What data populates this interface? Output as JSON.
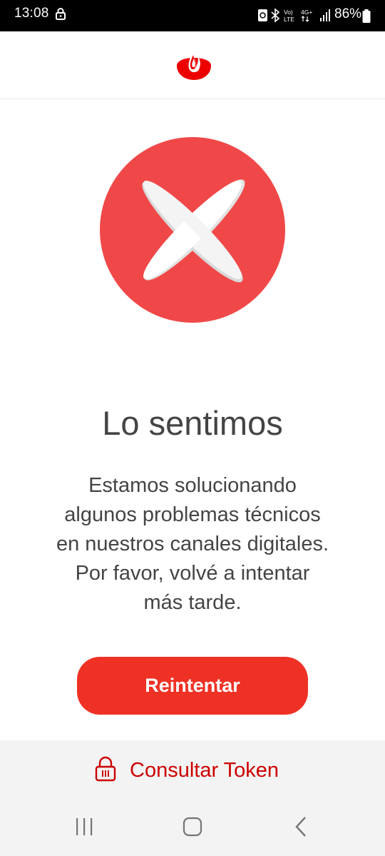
{
  "status_bar": {
    "time": "13:08",
    "battery": "86%",
    "icons": [
      "lock-icon",
      "data-saver-icon",
      "bluetooth-icon",
      "volte-icon",
      "4g-plus-icon",
      "signal-icon",
      "battery-icon"
    ],
    "volte_text_top": "Vo)",
    "volte_text_bottom": "LTE",
    "network_text": "4G+"
  },
  "header": {
    "logo": "santander-flame-logo",
    "logo_color": "#ec0000"
  },
  "error": {
    "icon": "error-x-icon",
    "circle_color": "#f04848",
    "title": "Lo sentimos",
    "message_lines": [
      "Estamos solucionando",
      "algunos problemas técnicos",
      "en nuestros canales digitales.",
      "Por favor, volvé a intentar",
      "más tarde."
    ]
  },
  "actions": {
    "retry_label": "Reintentar",
    "retry_color": "#ee3124"
  },
  "footer": {
    "token_label": "Consultar Token",
    "token_icon": "padlock-icon",
    "token_color": "#cc0000"
  },
  "navigation": {
    "buttons": [
      "recents-icon",
      "home-icon",
      "back-icon"
    ]
  }
}
